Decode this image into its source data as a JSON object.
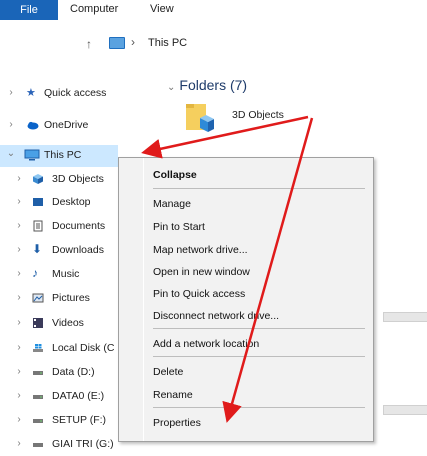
{
  "ribbon": {
    "file": "File",
    "tabs": [
      "Computer",
      "View"
    ]
  },
  "address": {
    "crumb": "This PC"
  },
  "nav": {
    "items": [
      {
        "label": "Quick access",
        "icon": "star-icon"
      },
      {
        "label": "OneDrive",
        "icon": "cloud-icon"
      },
      {
        "label": "This PC",
        "icon": "computer-icon"
      },
      {
        "label": "3D Objects",
        "icon": "cube-icon"
      },
      {
        "label": "Desktop",
        "icon": "desktop-icon"
      },
      {
        "label": "Documents",
        "icon": "document-icon"
      },
      {
        "label": "Downloads",
        "icon": "download-icon"
      },
      {
        "label": "Music",
        "icon": "music-icon"
      },
      {
        "label": "Pictures",
        "icon": "picture-icon"
      },
      {
        "label": "Videos",
        "icon": "video-icon"
      },
      {
        "label": "Local Disk (C",
        "icon": "windows-drive-icon"
      },
      {
        "label": "Data (D:)",
        "icon": "drive-icon"
      },
      {
        "label": "DATA0 (E:)",
        "icon": "drive-icon"
      },
      {
        "label": "SETUP (F:)",
        "icon": "drive-icon"
      },
      {
        "label": "GIAI TRI (G:)",
        "icon": "drive-icon"
      }
    ]
  },
  "main": {
    "folders_header": "Folders (7)",
    "folder_3d": "3D Objects"
  },
  "menu": {
    "items": [
      "Collapse",
      "Manage",
      "Pin to Start",
      "Map network drive...",
      "Open in new window",
      "Pin to Quick access",
      "Disconnect network drive...",
      "Add a network location",
      "Delete",
      "Rename",
      "Properties"
    ]
  },
  "colors": {
    "accent": "#1a65b8",
    "selection": "#cce8ff",
    "arrow": "#e01b1b"
  }
}
